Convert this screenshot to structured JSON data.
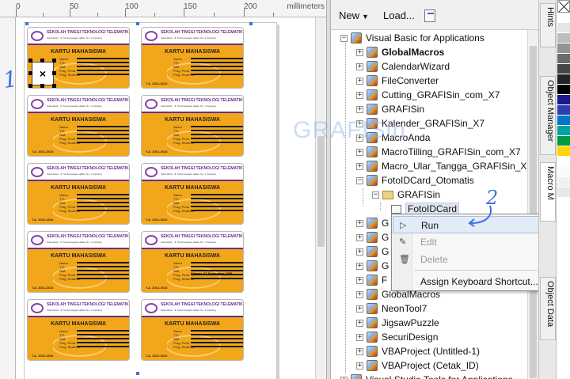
{
  "ruler": {
    "labels": [
      "0",
      "50",
      "100",
      "150",
      "200"
    ],
    "unit": "millimeters"
  },
  "card": {
    "school_name": "SEKOLAH TINGGI TEKNOLOGI TELEMATIKA",
    "address": "Sekretariat : Jl. Tarumanegara dalam No. 1 Cipinang",
    "title": "KARTU MAHASISWA",
    "fields": [
      "Nama",
      "TTL",
      "NIM",
      "Prog. Pend",
      "Prog. Studi/Jur"
    ],
    "year": "T.A. 2012-2013",
    "sample_birth": "Siawan, 07 September 1995"
  },
  "annotations": {
    "step1": "1",
    "step2": "2",
    "watermark": "GRAFISin"
  },
  "selection": {
    "glyph": "×"
  },
  "toolbar": {
    "new_label": "New",
    "load_label": "Load...",
    "arrow": "▼"
  },
  "tree": {
    "root": "Visual Basic for Applications",
    "items": [
      "GlobalMacros",
      "CalendarWizard",
      "FileConverter",
      "Cutting_GRAFISin_com_X7",
      "GRAFISin",
      "Kalender_GRAFISin_X7",
      "MacroAnda",
      "MacroTilling_GRAFISin_com_X7",
      "Macro_Ular_Tangga_GRAFISin_X7",
      "FotoIDCard_Otomatis"
    ],
    "sub_folder": "GRAFISin",
    "sub_module": "FotoIDCard",
    "clipped_rows": [
      "G",
      "G",
      "G",
      "G",
      "F"
    ],
    "items_after": [
      "GlobalMacros",
      "NeonTool7",
      "JigsawPuzzle",
      "SecuriDesign",
      "VBAProject (Untitled-1)",
      "VBAProject (Cetak_ID)"
    ],
    "bottom_partial": "Visual Studio Tools for Applications"
  },
  "context_menu": {
    "run": "Run",
    "edit": "Edit",
    "delete": "Delete",
    "assign": "Assign Keyboard Shortcut...",
    "run_glyph": "▷",
    "edit_glyph": "✎",
    "delete_glyph": "🗑"
  },
  "docker_tabs": {
    "hints": "Hints",
    "object_manager": "Object Manager",
    "macro_manager": "Macro M",
    "object_data": "Object Data"
  },
  "palette": {
    "colors": [
      "#ffffff",
      "#e6e6e6",
      "#bdbdbd",
      "#949494",
      "#6b6b6b",
      "#474747",
      "#242424",
      "#000000",
      "#1a1a8c",
      "#2b3fb5",
      "#0077c8",
      "#00a3a3",
      "#009944",
      "#ffd400",
      "#ffffff",
      "#fafafa",
      "#f0f0f0",
      "#e8e8e8"
    ]
  },
  "tree_expander": {
    "plus": "+",
    "minus": "−"
  }
}
